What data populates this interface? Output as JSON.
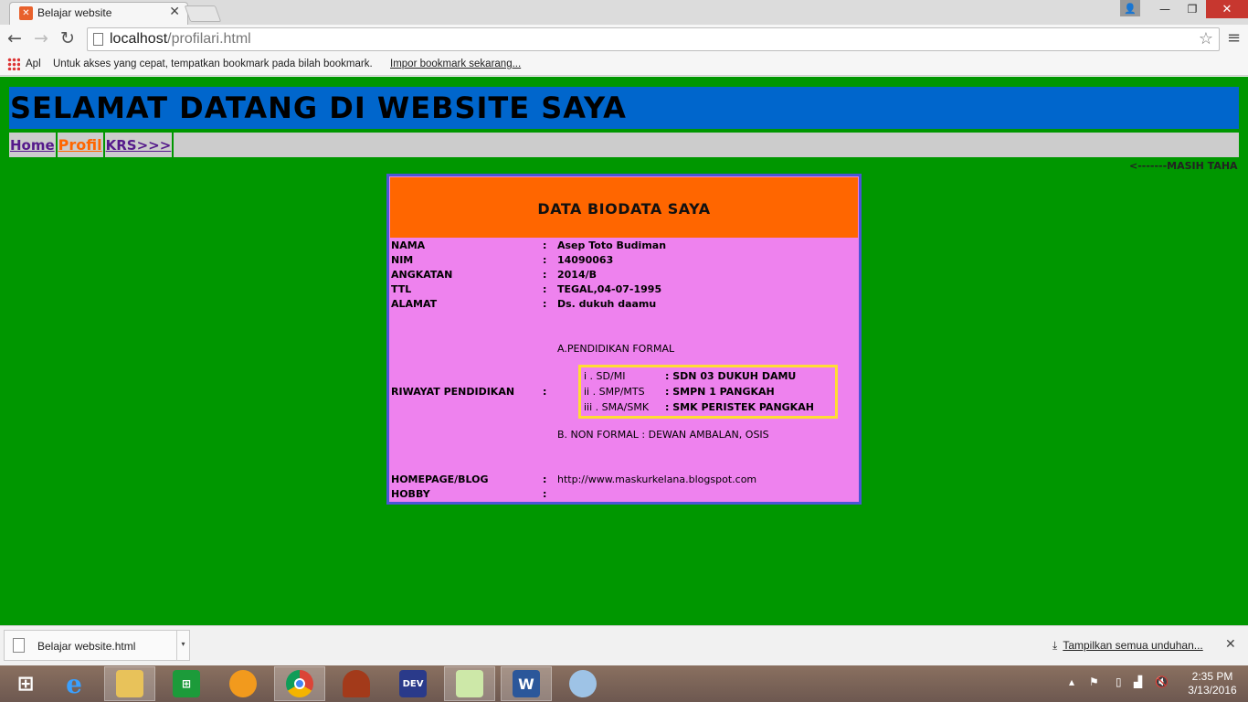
{
  "browser": {
    "tab_title": "Belajar website",
    "url_host": "localhost",
    "url_path": "/profilari.html",
    "bookmarks": {
      "apps_label": "Apl",
      "hint": "Untuk akses yang cepat, tempatkan bookmark pada bilah bookmark.",
      "import_link": "Impor bookmark sekarang..."
    }
  },
  "page": {
    "header_title": "SELAMAT DATANG DI WEBSITE SAYA",
    "nav": [
      "Home",
      "Profil",
      "KRS>>>"
    ],
    "marquee": "<-------MASIH TAHA",
    "card_title": "DATA BIODATA SAYA",
    "rows": [
      {
        "label": "NAMA",
        "sep": ":",
        "value": "Asep Toto Budiman"
      },
      {
        "label": "NIM",
        "sep": ":",
        "value": "14090063"
      },
      {
        "label": "ANGKATAN",
        "sep": ":",
        "value": "2014/B"
      },
      {
        "label": "TTL",
        "sep": ":",
        "value": "TEGAL,04-07-1995"
      },
      {
        "label": "ALAMAT",
        "sep": ":",
        "value": "Ds. dukuh daamu"
      }
    ],
    "riwayat": {
      "label": "RIWAYAT PENDIDIKAN",
      "sep": ":",
      "formal_heading": "A.PENDIDIKAN FORMAL",
      "schools": [
        {
          "level": "i . SD/MI",
          "school": ": SDN 03 DUKUH DAMU"
        },
        {
          "level": "ii . SMP/MTS",
          "school": ": SMPN 1 PANGKAH"
        },
        {
          "level": "iii . SMA/SMK",
          "school": ": SMK PERISTEK PANGKAH"
        }
      ],
      "non_formal": "B. NON FORMAL : DEWAN AMBALAN, OSIS"
    },
    "homepage": {
      "label": "HOMEPAGE/BLOG",
      "sep": ":",
      "value": "http://www.maskurkelana.blogspot.com"
    },
    "hobby": {
      "label": "HOBBY",
      "sep": ":",
      "value": ""
    }
  },
  "downloads": {
    "item_name": "Belajar website.html",
    "show_all": "Tampilkan semua unduhan..."
  },
  "taskbar": {
    "time": "2:35 PM",
    "date": "3/13/2016"
  },
  "colors": {
    "page_bg": "#009700",
    "header_bg": "#0066cc",
    "card_bg": "#ee82ee",
    "card_head_bg": "#ff6600",
    "edu_border": "#ffdd33"
  }
}
